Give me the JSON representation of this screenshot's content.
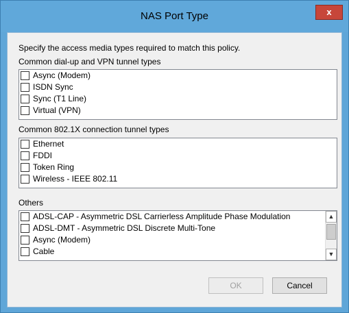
{
  "window": {
    "title": "NAS Port Type",
    "close_glyph": "x"
  },
  "instructions": "Specify the access media types required to match this policy.",
  "sections": [
    {
      "label": "Common dial-up and VPN tunnel types",
      "items": [
        {
          "label": "Async (Modem)",
          "checked": false
        },
        {
          "label": "ISDN Sync",
          "checked": false
        },
        {
          "label": "Sync (T1 Line)",
          "checked": false
        },
        {
          "label": "Virtual (VPN)",
          "checked": false
        }
      ]
    },
    {
      "label": "Common 802.1X connection tunnel types",
      "items": [
        {
          "label": "Ethernet",
          "checked": false
        },
        {
          "label": "FDDI",
          "checked": false
        },
        {
          "label": "Token Ring",
          "checked": false
        },
        {
          "label": "Wireless - IEEE 802.11",
          "checked": false
        }
      ]
    },
    {
      "label": "Others",
      "items": [
        {
          "label": "ADSL-CAP - Asymmetric DSL Carrierless Amplitude Phase Modulation",
          "checked": false
        },
        {
          "label": "ADSL-DMT - Asymmetric DSL Discrete Multi-Tone",
          "checked": false
        },
        {
          "label": "Async (Modem)",
          "checked": false
        },
        {
          "label": "Cable",
          "checked": false
        }
      ]
    }
  ],
  "buttons": {
    "ok": "OK",
    "cancel": "Cancel"
  },
  "colors": {
    "titlebar": "#60a8da",
    "close_button": "#c7463a",
    "dialog_bg": "#f0f0f0"
  }
}
